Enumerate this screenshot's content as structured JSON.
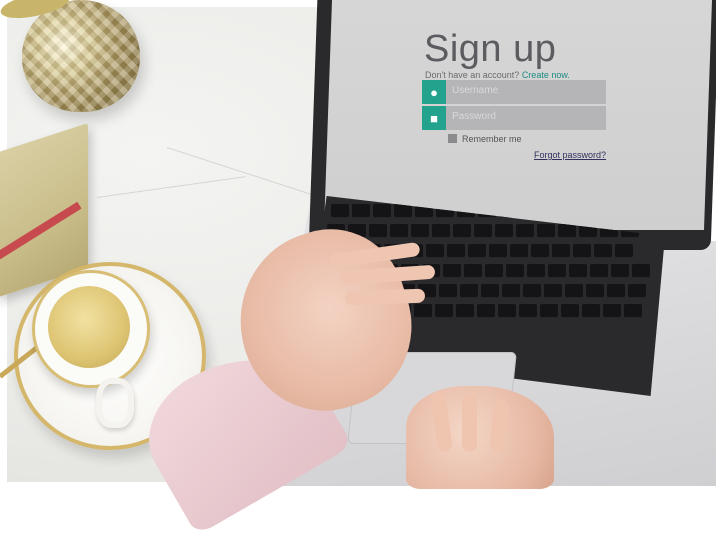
{
  "scene": {
    "description_icons": [
      "pineapple-ornament-icon",
      "notebook-icon",
      "tea-cup-icon",
      "laptop-icon"
    ]
  },
  "signup": {
    "title": "Sign up",
    "no_account_text": "Don't have an account?",
    "create_link": "Create now.",
    "username_placeholder": "Username",
    "password_placeholder": "Password",
    "remember_label": "Remember me",
    "forgot_link": "Forgot password?",
    "accent_color": "#23a28d"
  }
}
